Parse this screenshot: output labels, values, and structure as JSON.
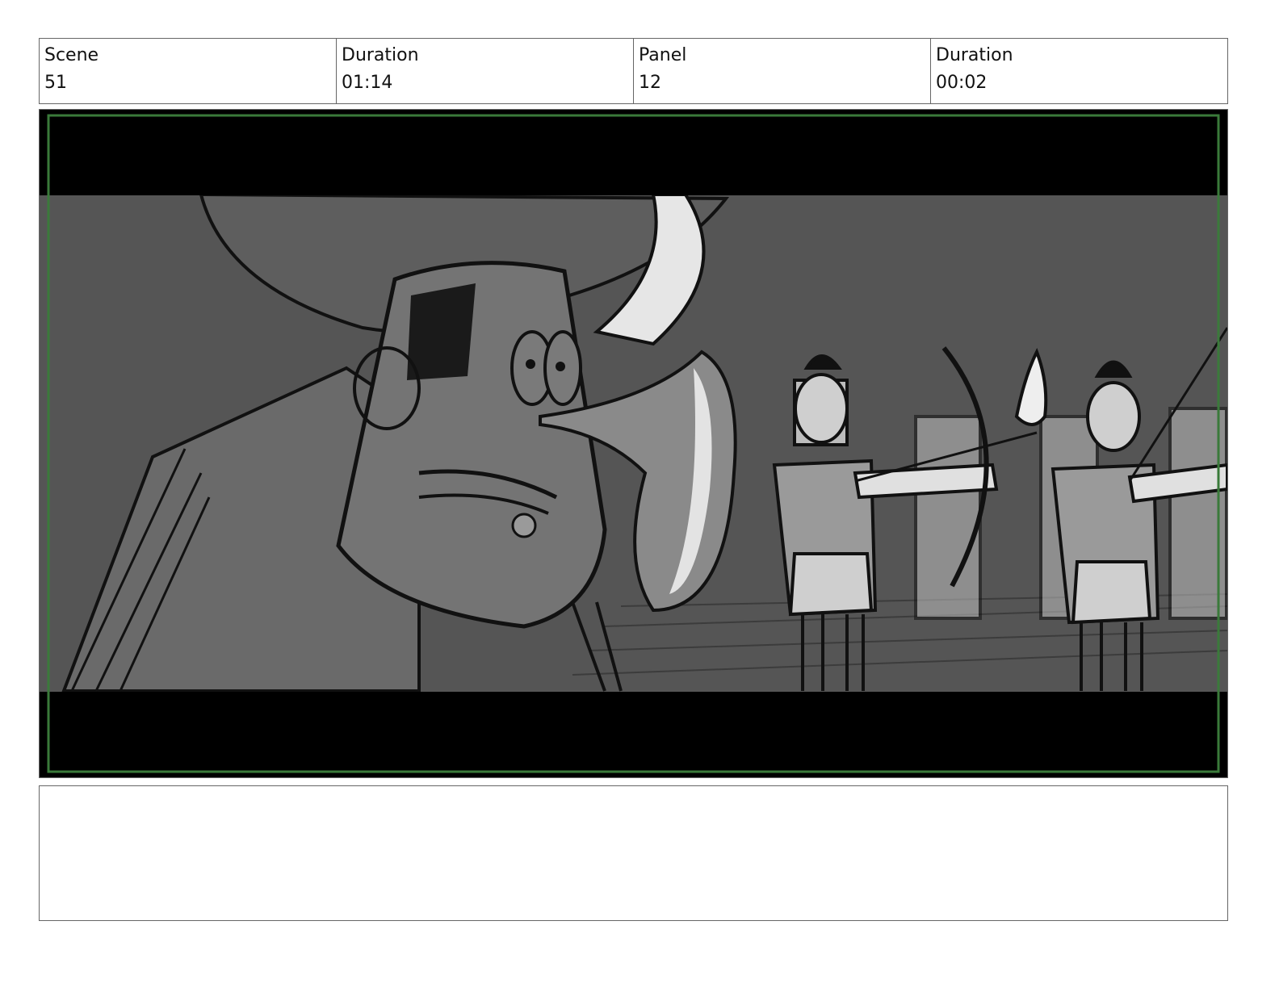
{
  "header": {
    "scene_label": "Scene",
    "scene_value": "51",
    "duration_label": "Duration",
    "duration_value": "01:14",
    "panel_label": "Panel",
    "panel_value": "12",
    "panel_duration_label": "Duration",
    "panel_duration_value": "00:02"
  },
  "notes": {
    "text": ""
  },
  "colors": {
    "frame_border": "#3a7a3a",
    "letterbox": "#000000",
    "background": "#5a5a5a"
  }
}
